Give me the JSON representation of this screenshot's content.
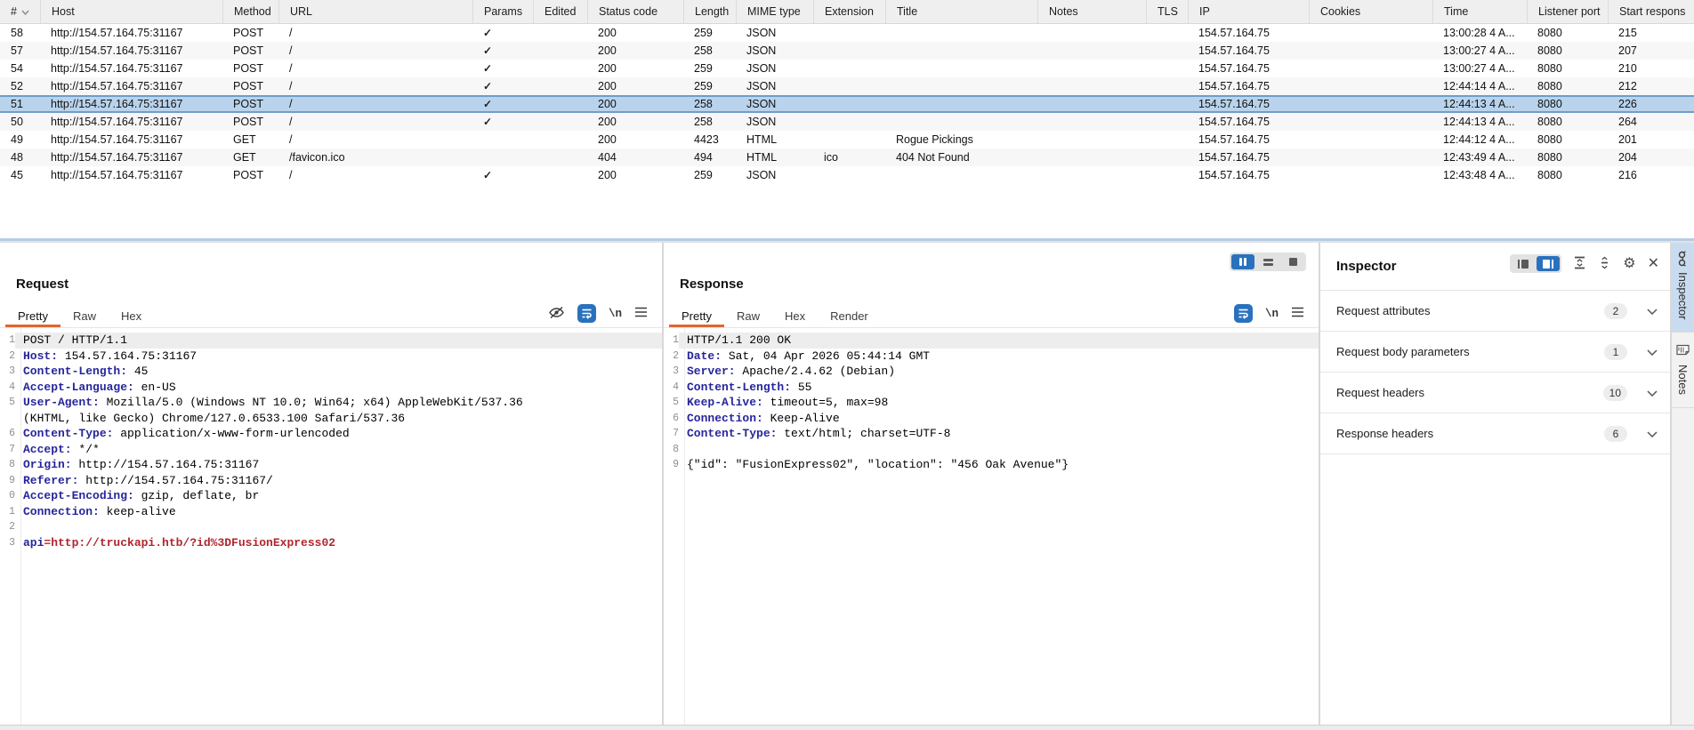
{
  "colors": {
    "accent_orange": "#e0662f",
    "selection_blue": "#b9d3ec",
    "selection_border_blue": "#6f9dc9",
    "active_button_blue": "#2a71bd",
    "header_name_blue": "#26269b",
    "param_value_red": "#b2252d",
    "side_tab_active_blue": "#c9dbef"
  },
  "icons": {
    "checkmark": "✓",
    "gear": "⚙",
    "close": "✕",
    "newline_label": "\\n"
  },
  "table": {
    "columns": [
      "#",
      "Host",
      "Method",
      "URL",
      "Params",
      "Edited",
      "Status code",
      "Length",
      "MIME type",
      "Extension",
      "Title",
      "Notes",
      "TLS",
      "IP",
      "Cookies",
      "Time",
      "Listener port",
      "Start respons"
    ],
    "sorted_column": "#",
    "sort_direction": "descending",
    "rows": [
      {
        "num": "58",
        "host": "http://154.57.164.75:31167",
        "method": "POST",
        "url": "/",
        "params": true,
        "edited": "",
        "status": "200",
        "length": "259",
        "mime": "JSON",
        "extension": "",
        "title": "",
        "notes": "",
        "tls": "",
        "ip": "154.57.164.75",
        "cookies": "",
        "time": "13:00:28 4 A...",
        "listener_port": "8080",
        "start_response": "215",
        "selected": false
      },
      {
        "num": "57",
        "host": "http://154.57.164.75:31167",
        "method": "POST",
        "url": "/",
        "params": true,
        "edited": "",
        "status": "200",
        "length": "258",
        "mime": "JSON",
        "extension": "",
        "title": "",
        "notes": "",
        "tls": "",
        "ip": "154.57.164.75",
        "cookies": "",
        "time": "13:00:27 4 A...",
        "listener_port": "8080",
        "start_response": "207",
        "selected": false
      },
      {
        "num": "54",
        "host": "http://154.57.164.75:31167",
        "method": "POST",
        "url": "/",
        "params": true,
        "edited": "",
        "status": "200",
        "length": "259",
        "mime": "JSON",
        "extension": "",
        "title": "",
        "notes": "",
        "tls": "",
        "ip": "154.57.164.75",
        "cookies": "",
        "time": "13:00:27 4 A...",
        "listener_port": "8080",
        "start_response": "210",
        "selected": false
      },
      {
        "num": "52",
        "host": "http://154.57.164.75:31167",
        "method": "POST",
        "url": "/",
        "params": true,
        "edited": "",
        "status": "200",
        "length": "259",
        "mime": "JSON",
        "extension": "",
        "title": "",
        "notes": "",
        "tls": "",
        "ip": "154.57.164.75",
        "cookies": "",
        "time": "12:44:14 4 A...",
        "listener_port": "8080",
        "start_response": "212",
        "selected": false
      },
      {
        "num": "51",
        "host": "http://154.57.164.75:31167",
        "method": "POST",
        "url": "/",
        "params": true,
        "edited": "",
        "status": "200",
        "length": "258",
        "mime": "JSON",
        "extension": "",
        "title": "",
        "notes": "",
        "tls": "",
        "ip": "154.57.164.75",
        "cookies": "",
        "time": "12:44:13 4 A...",
        "listener_port": "8080",
        "start_response": "226",
        "selected": true
      },
      {
        "num": "50",
        "host": "http://154.57.164.75:31167",
        "method": "POST",
        "url": "/",
        "params": true,
        "edited": "",
        "status": "200",
        "length": "258",
        "mime": "JSON",
        "extension": "",
        "title": "",
        "notes": "",
        "tls": "",
        "ip": "154.57.164.75",
        "cookies": "",
        "time": "12:44:13 4 A...",
        "listener_port": "8080",
        "start_response": "264",
        "selected": false
      },
      {
        "num": "49",
        "host": "http://154.57.164.75:31167",
        "method": "GET",
        "url": "/",
        "params": false,
        "edited": "",
        "status": "200",
        "length": "4423",
        "mime": "HTML",
        "extension": "",
        "title": "Rogue Pickings",
        "notes": "",
        "tls": "",
        "ip": "154.57.164.75",
        "cookies": "",
        "time": "12:44:12 4 A...",
        "listener_port": "8080",
        "start_response": "201",
        "selected": false
      },
      {
        "num": "48",
        "host": "http://154.57.164.75:31167",
        "method": "GET",
        "url": "/favicon.ico",
        "params": false,
        "edited": "",
        "status": "404",
        "length": "494",
        "mime": "HTML",
        "extension": "ico",
        "title": "404 Not Found",
        "notes": "",
        "tls": "",
        "ip": "154.57.164.75",
        "cookies": "",
        "time": "12:43:49 4 A...",
        "listener_port": "8080",
        "start_response": "204",
        "selected": false
      },
      {
        "num": "45",
        "host": "http://154.57.164.75:31167",
        "method": "POST",
        "url": "/",
        "params": true,
        "edited": "",
        "status": "200",
        "length": "259",
        "mime": "JSON",
        "extension": "",
        "title": "",
        "notes": "",
        "tls": "",
        "ip": "154.57.164.75",
        "cookies": "",
        "time": "12:43:48 4 A...",
        "listener_port": "8080",
        "start_response": "216",
        "selected": false
      }
    ]
  },
  "request_panel": {
    "title": "Request",
    "tabs": [
      "Pretty",
      "Raw",
      "Hex"
    ],
    "active_tab": "Pretty",
    "toolbar": [
      "hidden-fields",
      "word-wrap",
      "newline",
      "menu"
    ],
    "lines": [
      {
        "n": "1",
        "hl": true,
        "segs": [
          {
            "t": "POST / HTTP/1.1",
            "c": "plain"
          }
        ]
      },
      {
        "n": "2",
        "segs": [
          {
            "t": "Host:",
            "c": "name"
          },
          {
            "t": " 154.57.164.75:31167",
            "c": "plain"
          }
        ]
      },
      {
        "n": "3",
        "segs": [
          {
            "t": "Content-Length:",
            "c": "name"
          },
          {
            "t": " 45",
            "c": "plain"
          }
        ]
      },
      {
        "n": "4",
        "segs": [
          {
            "t": "Accept-Language:",
            "c": "name"
          },
          {
            "t": " en-US",
            "c": "plain"
          }
        ]
      },
      {
        "n": "5",
        "segs": [
          {
            "t": "User-Agent:",
            "c": "name"
          },
          {
            "t": " Mozilla/5.0 (Windows NT 10.0; Win64; x64) AppleWebKit/537.36 (KHTML, like Gecko) Chrome/127.0.6533.100 Safari/537.36",
            "c": "plain"
          }
        ]
      },
      {
        "n": "6",
        "segs": [
          {
            "t": "Content-Type:",
            "c": "name"
          },
          {
            "t": " application/x-www-form-urlencoded",
            "c": "plain"
          }
        ]
      },
      {
        "n": "7",
        "segs": [
          {
            "t": "Accept:",
            "c": "name"
          },
          {
            "t": " */*",
            "c": "plain"
          }
        ]
      },
      {
        "n": "8",
        "segs": [
          {
            "t": "Origin:",
            "c": "name"
          },
          {
            "t": " http://154.57.164.75:31167",
            "c": "plain"
          }
        ]
      },
      {
        "n": "9",
        "segs": [
          {
            "t": "Referer:",
            "c": "name"
          },
          {
            "t": " http://154.57.164.75:31167/",
            "c": "plain"
          }
        ]
      },
      {
        "n": "0",
        "segs": [
          {
            "t": "Accept-Encoding:",
            "c": "name"
          },
          {
            "t": " gzip, deflate, br",
            "c": "plain"
          }
        ]
      },
      {
        "n": "1",
        "segs": [
          {
            "t": "Connection:",
            "c": "name"
          },
          {
            "t": " keep-alive",
            "c": "plain"
          }
        ]
      },
      {
        "n": "2",
        "segs": []
      },
      {
        "n": "3",
        "segs": [
          {
            "t": "api",
            "c": "pname"
          },
          {
            "t": "=http://truckapi.htb/?id%3DFusionExpress02",
            "c": "pval"
          }
        ]
      }
    ]
  },
  "response_panel": {
    "title": "Response",
    "tabs": [
      "Pretty",
      "Raw",
      "Hex",
      "Render"
    ],
    "active_tab": "Pretty",
    "toolbar": [
      "word-wrap",
      "newline",
      "menu"
    ],
    "layout_buttons": [
      {
        "name": "split-columns",
        "active": true
      },
      {
        "name": "split-rows",
        "active": false
      },
      {
        "name": "single-pane",
        "active": false
      }
    ],
    "lines": [
      {
        "n": "1",
        "hl": true,
        "segs": [
          {
            "t": "HTTP/1.1 200 OK",
            "c": "plain"
          }
        ]
      },
      {
        "n": "2",
        "segs": [
          {
            "t": "Date:",
            "c": "name"
          },
          {
            "t": " Sat, 04 Apr 2026 05:44:14 GMT",
            "c": "plain"
          }
        ]
      },
      {
        "n": "3",
        "segs": [
          {
            "t": "Server:",
            "c": "name"
          },
          {
            "t": " Apache/2.4.62 (Debian)",
            "c": "plain"
          }
        ]
      },
      {
        "n": "4",
        "segs": [
          {
            "t": "Content-Length:",
            "c": "name"
          },
          {
            "t": " 55",
            "c": "plain"
          }
        ]
      },
      {
        "n": "5",
        "segs": [
          {
            "t": "Keep-Alive:",
            "c": "name"
          },
          {
            "t": " timeout=5, max=98",
            "c": "plain"
          }
        ]
      },
      {
        "n": "6",
        "segs": [
          {
            "t": "Connection:",
            "c": "name"
          },
          {
            "t": " Keep-Alive",
            "c": "plain"
          }
        ]
      },
      {
        "n": "7",
        "segs": [
          {
            "t": "Content-Type:",
            "c": "name"
          },
          {
            "t": " text/html; charset=UTF-8",
            "c": "plain"
          }
        ]
      },
      {
        "n": "8",
        "segs": []
      },
      {
        "n": "9",
        "segs": [
          {
            "t": "{\"id\": \"FusionExpress02\", \"location\": \"456 Oak Avenue\"}",
            "c": "plain"
          }
        ]
      }
    ]
  },
  "inspector": {
    "title": "Inspector",
    "toolbar": [
      {
        "name": "dock-left",
        "active": false
      },
      {
        "name": "dock-right",
        "active": true
      },
      {
        "name": "collapse-all",
        "active": false
      },
      {
        "name": "expand-all",
        "active": false
      },
      {
        "name": "settings",
        "active": false
      },
      {
        "name": "close",
        "active": false
      }
    ],
    "sections": [
      {
        "label": "Request attributes",
        "count": "2"
      },
      {
        "label": "Request body parameters",
        "count": "1"
      },
      {
        "label": "Request headers",
        "count": "10"
      },
      {
        "label": "Response headers",
        "count": "6"
      }
    ]
  },
  "side_tabs": [
    {
      "label": "Inspector",
      "icon": "inspector-icon",
      "active": true
    },
    {
      "label": "Notes",
      "icon": "notes-icon",
      "active": false
    }
  ]
}
